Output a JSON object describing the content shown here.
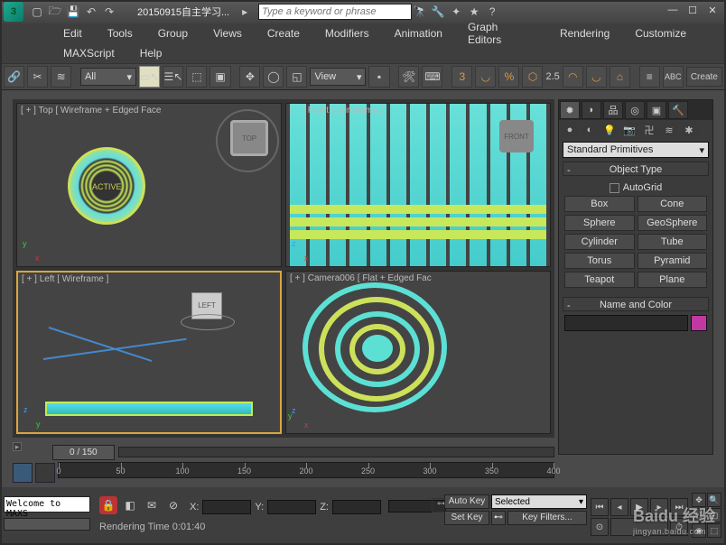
{
  "titlebar": {
    "doc_title": "20150915自主学习...",
    "search_placeholder": "Type a keyword or phrase"
  },
  "menu_row1": [
    "Edit",
    "Tools",
    "Group",
    "Views",
    "Create",
    "Modifiers",
    "Animation",
    "Graph Editors",
    "Rendering",
    "Customize"
  ],
  "menu_row2": [
    "MAXScript",
    "Help"
  ],
  "toolbar": {
    "filter_dd": "All",
    "view_dd": "View",
    "angle_value": "2.5",
    "create_label": "Create"
  },
  "viewports": {
    "top": {
      "label": "[ + ]  Top  [ Wireframe + Edged Face",
      "cube": "TOP",
      "ring": "ACTIVE"
    },
    "front": {
      "label": "[ + ]  Front  [ Wireframe ]",
      "cube": "FRONT"
    },
    "left": {
      "label": "[ + ]  Left  [ Wireframe ]",
      "cube": "LEFT"
    },
    "cam": {
      "label": "[ + ]  Camera006  [ Flat + Edged Fac"
    }
  },
  "panel": {
    "category_dd": "Standard Primitives",
    "rollout_objtype": "Object Type",
    "autogrid": "AutoGrid",
    "objects": [
      "Box",
      "Cone",
      "Sphere",
      "GeoSphere",
      "Cylinder",
      "Tube",
      "Torus",
      "Pyramid",
      "Teapot",
      "Plane"
    ],
    "rollout_name": "Name and Color"
  },
  "track": {
    "frame_label": "0 / 150"
  },
  "ruler_ticks": [
    "0",
    "50",
    "100",
    "150",
    "200",
    "250",
    "300",
    "350",
    "400"
  ],
  "status": {
    "welcome": "Welcome to MAXS",
    "coord_x": "X:",
    "coord_y": "Y:",
    "coord_z": "Z:",
    "render_log": "Rendering Time  0:01:40",
    "auto_key": "Auto Key",
    "set_key": "Set Key",
    "selected": "Selected",
    "key_filters": "Key Filters..."
  },
  "watermark": {
    "brand": "Baidu 经验",
    "url": "jingyan.baidu.com"
  }
}
